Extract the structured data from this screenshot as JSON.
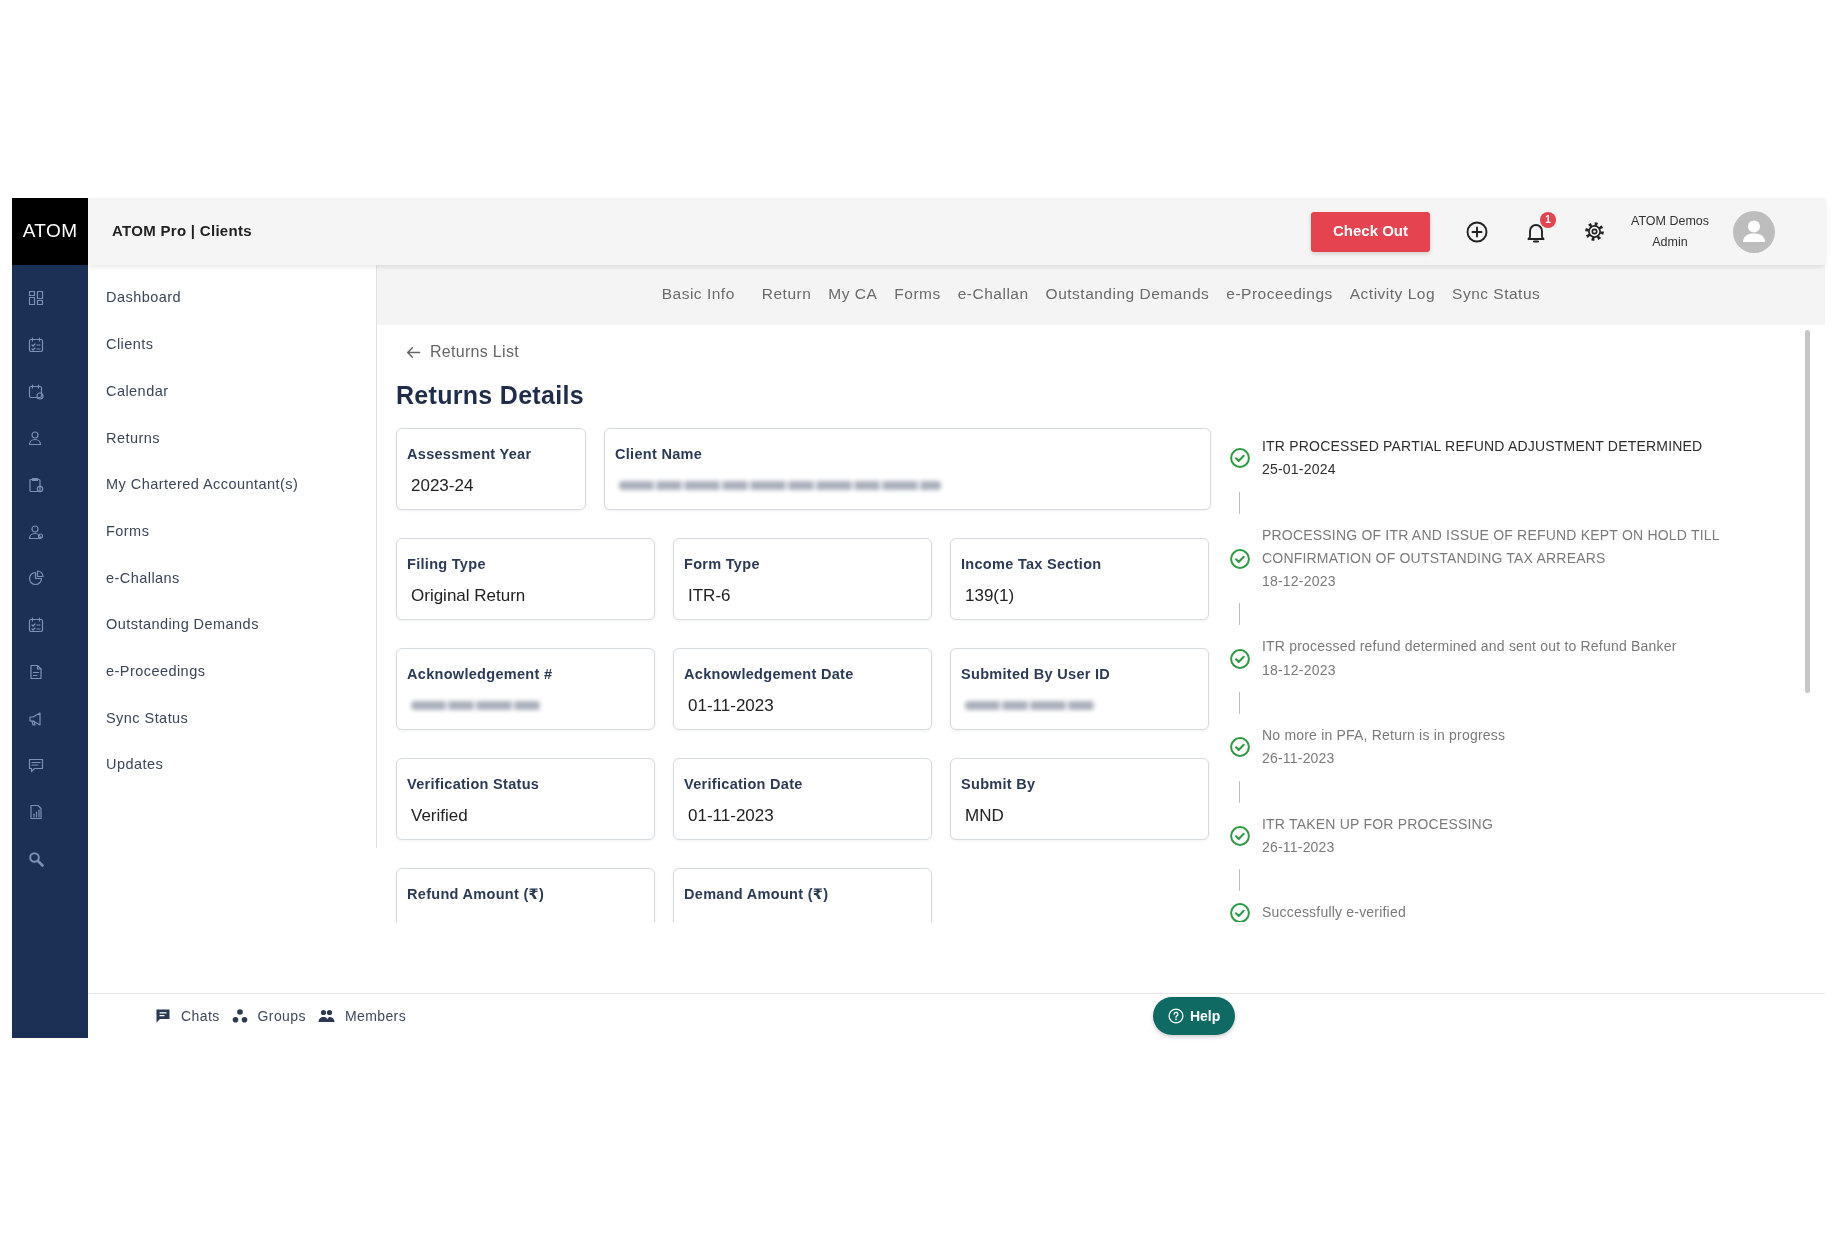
{
  "logo": "ATOM",
  "header": {
    "title": "ATOM Pro | Clients",
    "checkout_button": "Check Out",
    "notification_count": "1",
    "user_name": "ATOM Demos",
    "user_role": "Admin"
  },
  "sidebar": {
    "items": [
      {
        "label": "Dashboard",
        "selected": false
      },
      {
        "label": "Clients",
        "selected": false
      },
      {
        "label": "Calendar",
        "selected": false
      },
      {
        "label": "Returns",
        "selected": false
      },
      {
        "label": "My Chartered Accountant(s)",
        "selected": false
      },
      {
        "label": "Forms",
        "selected": false
      },
      {
        "label": "e-Challans",
        "selected": false
      },
      {
        "label": "Outstanding Demands",
        "selected": false
      },
      {
        "label": "e-Proceedings",
        "selected": false
      },
      {
        "label": "Sync Status",
        "selected": false
      },
      {
        "label": "Updates",
        "selected": false
      }
    ]
  },
  "tabs": [
    {
      "label": "Basic Info",
      "selected": false
    },
    {
      "label": "Return",
      "selected": false
    },
    {
      "label": "My CA",
      "selected": false
    },
    {
      "label": "Forms",
      "selected": false
    },
    {
      "label": "e-Challan",
      "selected": false
    },
    {
      "label": "Outstanding Demands",
      "selected": false
    },
    {
      "label": "e-Proceedings",
      "selected": false
    },
    {
      "label": "Activity Log",
      "selected": false
    },
    {
      "label": "Sync Status",
      "selected": false
    }
  ],
  "back_link": "Returns List",
  "page_title": "Returns Details",
  "field_rows": [
    {
      "kind": "split",
      "fields": [
        {
          "label": "Assessment Year",
          "value": "2023-24",
          "blurred": false
        },
        {
          "label": "Client Name",
          "blurred": true
        }
      ]
    },
    {
      "kind": "thirds",
      "fields": [
        {
          "label": "Filing Type",
          "value": "Original Return",
          "blurred": false
        },
        {
          "label": "Form Type",
          "value": "ITR-6",
          "blurred": false
        },
        {
          "label": "Income Tax Section",
          "value": "139(1)",
          "blurred": false
        }
      ]
    },
    {
      "kind": "thirds",
      "fields": [
        {
          "label": "Acknowledgement #",
          "blurred": true
        },
        {
          "label": "Acknowledgement Date",
          "value": "01-11-2023",
          "blurred": false
        },
        {
          "label": "Submited By User ID",
          "blurred": true
        }
      ]
    },
    {
      "kind": "thirds",
      "fields": [
        {
          "label": "Verification Status",
          "value": "Verified",
          "blurred": false
        },
        {
          "label": "Verification Date",
          "value": "01-11-2023",
          "blurred": false
        },
        {
          "label": "Submit By",
          "value": "MND",
          "blurred": false
        }
      ]
    },
    {
      "kind": "thirds",
      "fields": [
        {
          "label": "Refund Amount (₹)",
          "blurred": false
        },
        {
          "label": "Demand Amount (₹)",
          "blurred": false
        }
      ]
    }
  ],
  "timeline": [
    {
      "title": "ITR PROCESSED PARTIAL REFUND ADJUSTMENT DETERMINED",
      "date": "25-01-2024",
      "current": true
    },
    {
      "title": "PROCESSING OF ITR AND ISSUE OF REFUND KEPT ON HOLD TILL CONFIRMATION OF OUTSTANDING TAX ARREARS",
      "date": "18-12-2023",
      "current": false
    },
    {
      "title": "ITR processed refund determined and sent out to Refund Banker",
      "date": "18-12-2023",
      "current": false
    },
    {
      "title": "No more in PFA, Return is in progress",
      "date": "26-11-2023",
      "current": false
    },
    {
      "title": "ITR TAKEN UP FOR PROCESSING",
      "date": "26-11-2023",
      "current": false
    },
    {
      "title": "Successfully e-verified",
      "current": false
    }
  ],
  "footer": {
    "links": [
      {
        "label": "Chats",
        "kind": "chats"
      },
      {
        "label": "Groups",
        "kind": "groups"
      },
      {
        "label": "Members",
        "kind": "members"
      }
    ],
    "help_button": "Help"
  }
}
